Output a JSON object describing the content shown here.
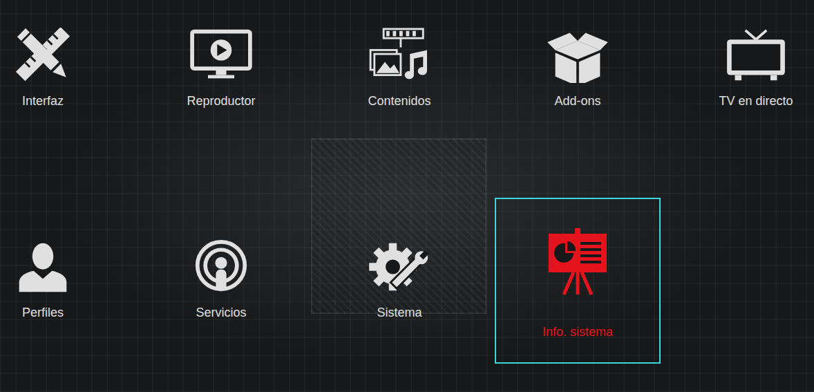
{
  "menu": {
    "items": [
      {
        "label": "Interfaz",
        "selected": false
      },
      {
        "label": "Reproductor",
        "selected": false
      },
      {
        "label": "Contenidos",
        "selected": false
      },
      {
        "label": "Add-ons",
        "selected": false
      },
      {
        "label": "TV en directo",
        "selected": false
      },
      {
        "label": "Perfiles",
        "selected": false
      },
      {
        "label": "Servicios",
        "selected": false
      },
      {
        "label": "Sistema",
        "selected": false
      },
      {
        "label": "Info. sistema",
        "selected": true
      }
    ]
  }
}
